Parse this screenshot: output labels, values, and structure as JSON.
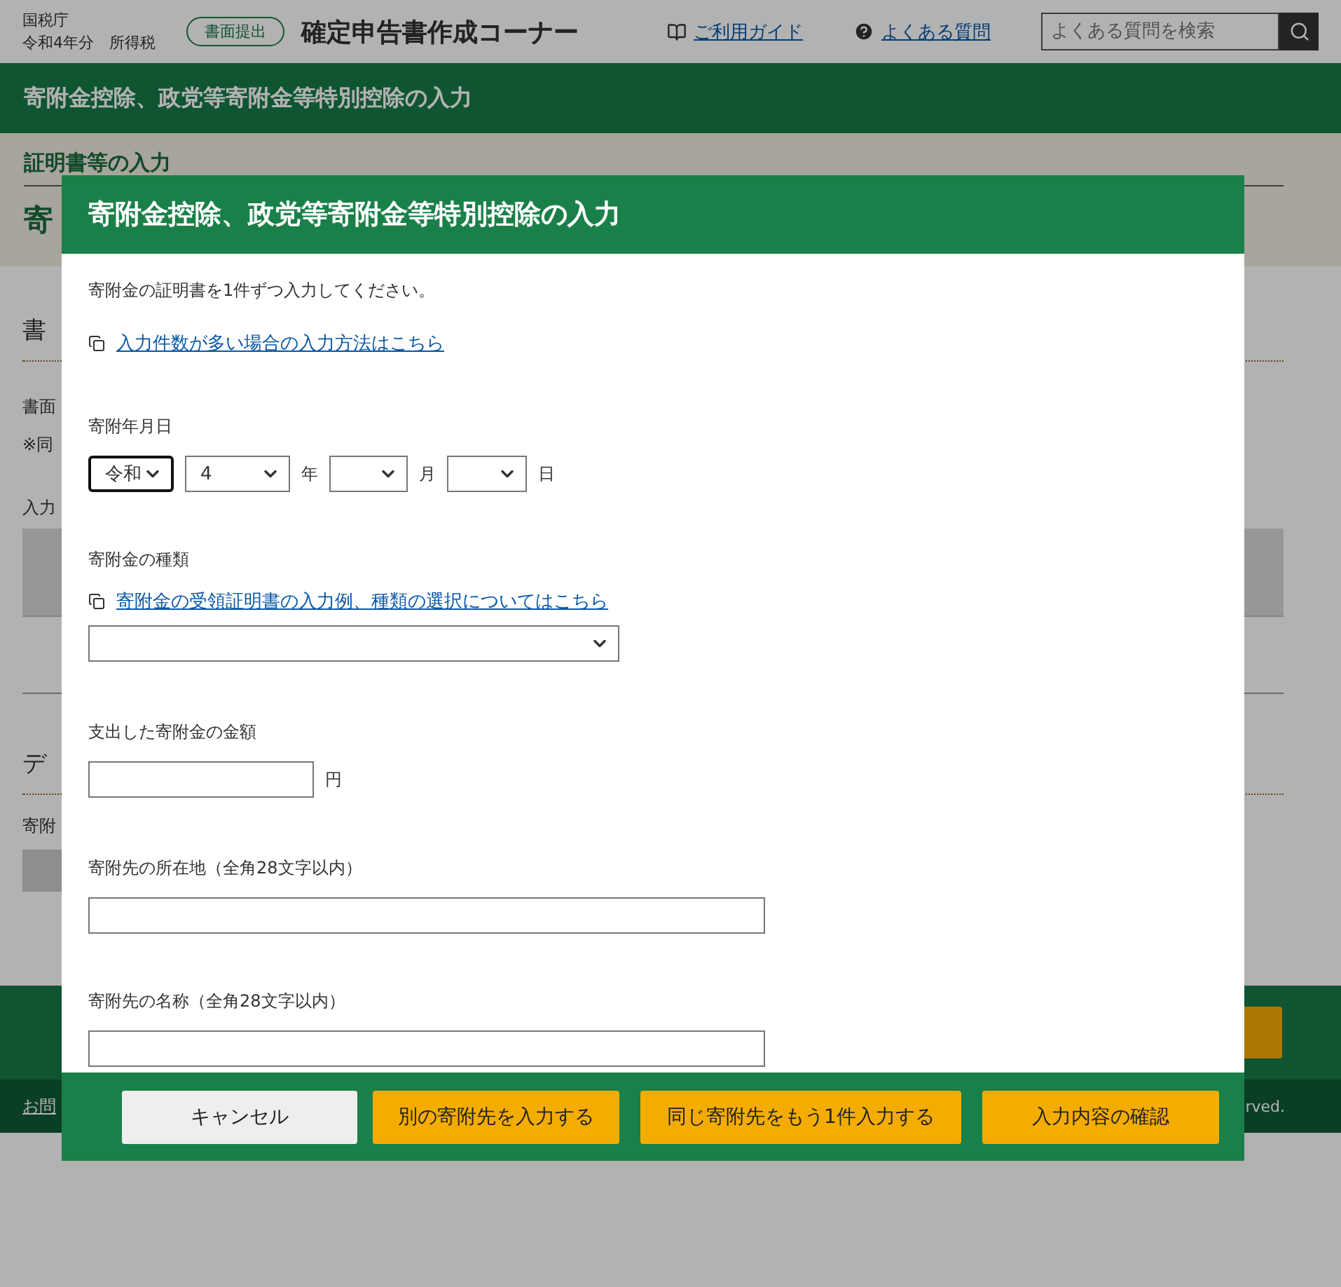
{
  "header": {
    "agency": "国税庁",
    "year_tax": "令和4年分　所得税",
    "pill": "書面提出",
    "title": "確定申告書作成コーナー",
    "guide_link": "ご利用ガイド",
    "faq_link": "よくある質問",
    "search": {
      "placeholder": "よくある質問を検索"
    }
  },
  "page_title": "寄附金控除、政党等寄附金等特別控除の入力",
  "background": {
    "section_heading": "証明書等の入力",
    "big_heading": "寄",
    "heading_1": "書",
    "text_1": "書面",
    "note_1": "※同",
    "label_1": "入力",
    "heading_2": "デ",
    "label_2": "寄附",
    "footer_link": "お問",
    "copyright": "rved."
  },
  "dialog": {
    "title": "寄附金控除、政党等寄附金等特別控除の入力",
    "intro": "寄附金の証明書を1件ずつ入力してください。",
    "bulk_link": "入力件数が多い場合の入力方法はこちら",
    "date": {
      "label": "寄附年月日",
      "era": "令和",
      "year": "4",
      "year_unit": "年",
      "month_unit": "月",
      "day_unit": "日"
    },
    "type": {
      "label": "寄附金の種類",
      "help_link": "寄附金の受領証明書の入力例、種類の選択についてはこちら"
    },
    "amount": {
      "label": "支出した寄附金の金額",
      "unit": "円"
    },
    "address": {
      "label": "寄附先の所在地（全角28文字以内）"
    },
    "name": {
      "label": "寄附先の名称（全角28文字以内）"
    },
    "buttons": [
      {
        "label": "キャンセル",
        "kind": "secondary"
      },
      {
        "label": "別の寄附先を入力する",
        "kind": "primary"
      },
      {
        "label": "同じ寄附先をもう1件入力する",
        "kind": "primary"
      },
      {
        "label": "入力内容の確認",
        "kind": "primary"
      }
    ]
  }
}
